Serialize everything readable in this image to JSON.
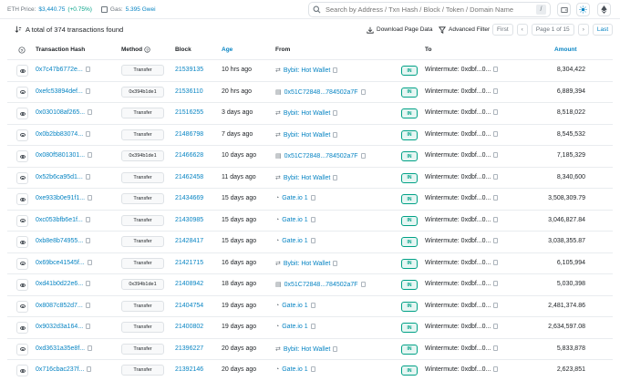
{
  "topbar": {
    "eth_price_label": "ETH Price:",
    "eth_price_value": "$3,440.75",
    "eth_price_change": "(+0.75%)",
    "gas_label": "Gas:",
    "gas_value": "5.395 Gwei",
    "search_placeholder": "Search by Address / Txn Hash / Block / Token / Domain Name",
    "search_shortcut": "/"
  },
  "toolbar": {
    "summary": "A total of 374 transactions found",
    "download_label": "Download Page Data",
    "filter_label": "Advanced Filter",
    "pager": {
      "first": "First",
      "page_text": "Page 1 of 15",
      "last": "Last"
    }
  },
  "table": {
    "headers": {
      "hash": "Transaction Hash",
      "method": "Method",
      "block": "Block",
      "age": "Age",
      "from": "From",
      "to": "To",
      "amount": "Amount"
    },
    "rows": [
      {
        "hash": "0x7c47b6772e...",
        "method": "Transfer",
        "block": "21539135",
        "age": "10 hrs ago",
        "from": "Bybit: Hot Wallet",
        "from_icon": "wallet",
        "dir": "IN",
        "to": "Wintermute: 0xdbf...0...",
        "amount": "8,304,422"
      },
      {
        "hash": "0xefc53894def...",
        "method": "0x394b1de1",
        "block": "21536110",
        "age": "20 hrs ago",
        "from": "0x51C72848...784502a7F",
        "from_icon": "contract",
        "dir": "IN",
        "to": "Wintermute: 0xdbf...0...",
        "amount": "6,889,394"
      },
      {
        "hash": "0x030108af265...",
        "method": "Transfer",
        "block": "21516255",
        "age": "3 days ago",
        "from": "Bybit: Hot Wallet",
        "from_icon": "wallet",
        "dir": "IN",
        "to": "Wintermute: 0xdbf...0...",
        "amount": "8,518,022"
      },
      {
        "hash": "0x0b2bb83074...",
        "method": "Transfer",
        "block": "21486798",
        "age": "7 days ago",
        "from": "Bybit: Hot Wallet",
        "from_icon": "wallet",
        "dir": "IN",
        "to": "Wintermute: 0xdbf...0...",
        "amount": "8,545,532"
      },
      {
        "hash": "0x080f5801301...",
        "method": "0x394b1de1",
        "block": "21466628",
        "age": "10 days ago",
        "from": "0x51C72848...784502a7F",
        "from_icon": "contract",
        "dir": "IN",
        "to": "Wintermute: 0xdbf...0...",
        "amount": "7,185,329"
      },
      {
        "hash": "0x52b6ca95d1...",
        "method": "Transfer",
        "block": "21462458",
        "age": "11 days ago",
        "from": "Bybit: Hot Wallet",
        "from_icon": "wallet",
        "dir": "IN",
        "to": "Wintermute: 0xdbf...0...",
        "amount": "8,340,600"
      },
      {
        "hash": "0xe933b0e91f1...",
        "method": "Transfer",
        "block": "21434669",
        "age": "15 days ago",
        "from": "Gate.io 1",
        "from_icon": "gate",
        "dir": "IN",
        "to": "Wintermute: 0xdbf...0...",
        "amount": "3,508,309.79"
      },
      {
        "hash": "0xc053bfb6e1f...",
        "method": "Transfer",
        "block": "21430985",
        "age": "15 days ago",
        "from": "Gate.io 1",
        "from_icon": "gate",
        "dir": "IN",
        "to": "Wintermute: 0xdbf...0...",
        "amount": "3,046,827.84"
      },
      {
        "hash": "0xb8e8b74955...",
        "method": "Transfer",
        "block": "21428417",
        "age": "15 days ago",
        "from": "Gate.io 1",
        "from_icon": "gate",
        "dir": "IN",
        "to": "Wintermute: 0xdbf...0...",
        "amount": "3,038,355.87"
      },
      {
        "hash": "0x69bce41545f...",
        "method": "Transfer",
        "block": "21421715",
        "age": "16 days ago",
        "from": "Bybit: Hot Wallet",
        "from_icon": "wallet",
        "dir": "IN",
        "to": "Wintermute: 0xdbf...0...",
        "amount": "6,105,994"
      },
      {
        "hash": "0xd41b0d22e6...",
        "method": "0x394b1de1",
        "block": "21408942",
        "age": "18 days ago",
        "from": "0x51C72848...784502a7F",
        "from_icon": "contract",
        "dir": "IN",
        "to": "Wintermute: 0xdbf...0...",
        "amount": "5,030,398"
      },
      {
        "hash": "0x8087c852d7...",
        "method": "Transfer",
        "block": "21404754",
        "age": "19 days ago",
        "from": "Gate.io 1",
        "from_icon": "gate",
        "dir": "IN",
        "to": "Wintermute: 0xdbf...0...",
        "amount": "2,481,374.86"
      },
      {
        "hash": "0x9032d3a164...",
        "method": "Transfer",
        "block": "21400802",
        "age": "19 days ago",
        "from": "Gate.io 1",
        "from_icon": "gate",
        "dir": "IN",
        "to": "Wintermute: 0xdbf...0...",
        "amount": "2,634,597.08"
      },
      {
        "hash": "0xd3631a35e8f...",
        "method": "Transfer",
        "block": "21396227",
        "age": "20 days ago",
        "from": "Bybit: Hot Wallet",
        "from_icon": "wallet",
        "dir": "IN",
        "to": "Wintermute: 0xdbf...0...",
        "amount": "5,833,878"
      },
      {
        "hash": "0x716cbac237f...",
        "method": "Transfer",
        "block": "21392146",
        "age": "20 days ago",
        "from": "Gate.io 1",
        "from_icon": "gate",
        "dir": "IN",
        "to": "Wintermute: 0xdbf...0...",
        "amount": "2,623,851"
      }
    ]
  }
}
